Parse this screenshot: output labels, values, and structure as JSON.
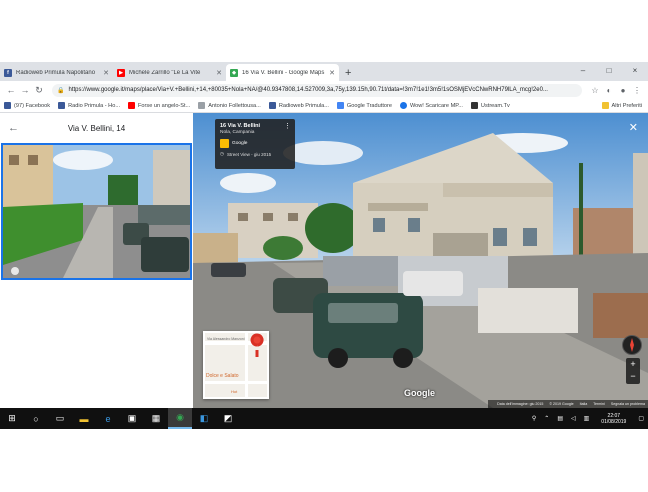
{
  "tabs": [
    {
      "label": "Radioweb Primula Napolitano",
      "fav_color": "#3b5998",
      "fav_glyph": "f",
      "active": false
    },
    {
      "label": "Michele Zarrillo \"Le La Vite",
      "fav_color": "#ff0000",
      "fav_glyph": "▶",
      "active": false
    },
    {
      "label": "16 Via V. Bellini - Google Maps",
      "fav_color": "#34a853",
      "fav_glyph": "◆",
      "active": true
    }
  ],
  "new_tab_label": "+",
  "window_controls": [
    "–",
    "□",
    "×"
  ],
  "address_bar": {
    "url": "https://www.google.it/maps/place/Via+V.+Bellini,+14,+80035+Nola+NA/@40.9347808,14.527009,3a,75y,139.15h,90.71t/data=!3m7!1e1!3m5!1sOSMjEVcCNwRNH79lLA_mcg!2e0..."
  },
  "bookmarks": [
    {
      "label": "(97) Facebook",
      "color": "#3b5998"
    },
    {
      "label": "Radio Primula - Ho...",
      "color": "#3b5998"
    },
    {
      "label": "Forse un angelo-St...",
      "color": "#ff0000"
    },
    {
      "label": "Antonio Follettousa...",
      "color": "#9aa0a6"
    },
    {
      "label": "Radioweb Primula...",
      "color": "#3b5998"
    },
    {
      "label": "Google Traduttore",
      "color": "#4285f4"
    },
    {
      "label": "Wow! Scaricare MP...",
      "color": "#1a73e8"
    },
    {
      "label": "Ustream.Tv",
      "color": "#333333"
    },
    {
      "label": "Altri Preferiti",
      "color": "#f1c232"
    }
  ],
  "left_panel": {
    "title": "Via V. Bellini, 14"
  },
  "info_card": {
    "address": "16 Via V. Bellini",
    "city": "Nola, Campania",
    "brand": "Google",
    "capture": "Street View - giu 2015"
  },
  "minimap": {
    "street": "Via Alessandro Manzoni",
    "place1": "Dolce e Salato",
    "place2": "Hot"
  },
  "google_logo": "Google",
  "attribution": [
    "Data dell'immagine: giu 2015",
    "© 2019 Google",
    "Italia",
    "Termini",
    "Segnala un problema"
  ],
  "taskbar": {
    "time": "22:07",
    "date": "01/08/2019"
  }
}
